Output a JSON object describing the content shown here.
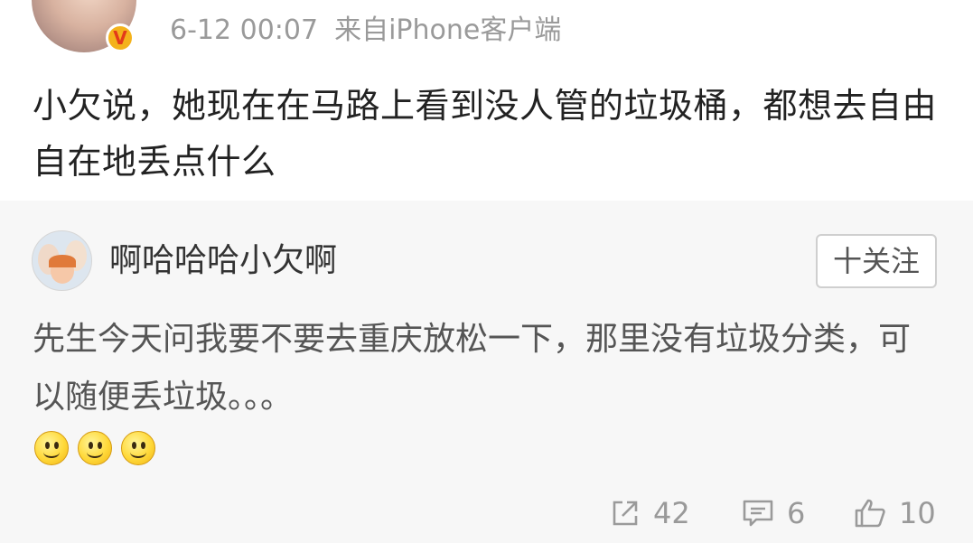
{
  "post": {
    "badge": "V",
    "time": "6-12 00:07",
    "source": "来自iPhone客户端",
    "text": "小欠说，她现在在马路上看到没人管的垃圾桶，都想去自由自在地丢点什么"
  },
  "repost": {
    "author": "啊哈哈哈小欠啊",
    "follow_label": "十关注",
    "text": "先生今天问我要不要去重庆放松一下，那里没有垃圾分类，可以随便丢垃圾。。。",
    "emoji_count": 3,
    "emoji_icon": "smile-emoji"
  },
  "actions": {
    "repost_count": "42",
    "comment_count": "6",
    "like_count": "10"
  },
  "colors": {
    "background_top": "#ffffff",
    "background_repost": "#f7f7f7",
    "meta_text": "#9a9a9a",
    "badge_fill": "#f4b21b",
    "badge_text": "#e33b1a"
  }
}
